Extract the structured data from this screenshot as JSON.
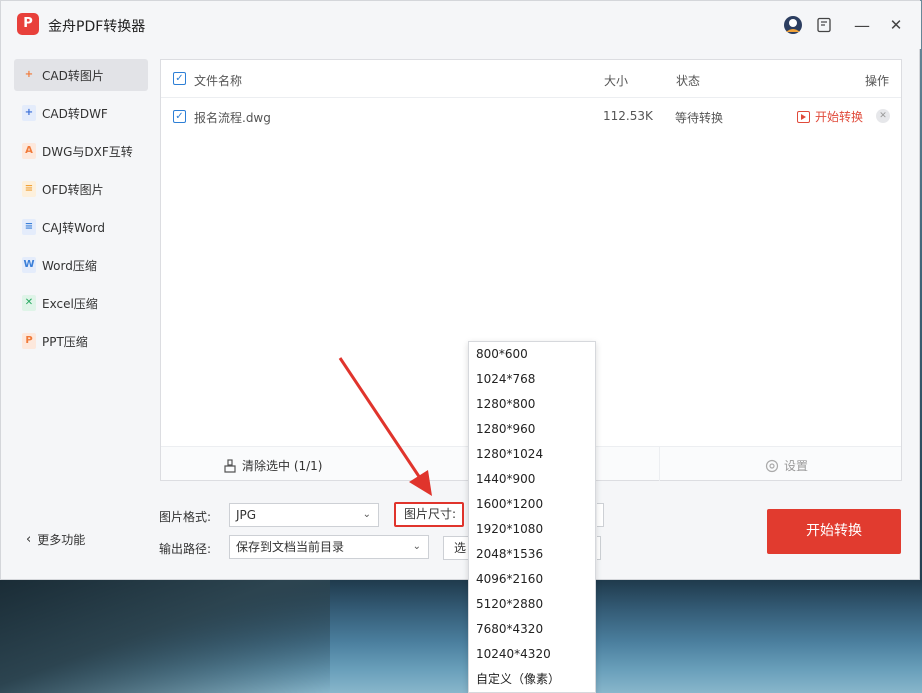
{
  "app": {
    "title": "金舟PDF转换器",
    "logo_text": "P"
  },
  "window_controls": {
    "minimize": "—",
    "close": "✕"
  },
  "sidebar": {
    "items": [
      {
        "label": "CAD转图片",
        "icon": "cad-image-icon",
        "color": "#f07a3a",
        "glyph": "+"
      },
      {
        "label": "CAD转DWF",
        "icon": "cad-dwf-icon",
        "color": "#3b6fd8",
        "glyph": "+"
      },
      {
        "label": "DWG与DXF互转",
        "icon": "dwg-dxf-icon",
        "color": "#f07a3a",
        "glyph": "A"
      },
      {
        "label": "OFD转图片",
        "icon": "ofd-icon",
        "color": "#f0a23a",
        "glyph": "≡"
      },
      {
        "label": "CAJ转Word",
        "icon": "caj-icon",
        "color": "#3b7fd8",
        "glyph": "≡"
      },
      {
        "label": "Word压缩",
        "icon": "word-icon",
        "color": "#3b7fd8",
        "glyph": "W"
      },
      {
        "label": "Excel压缩",
        "icon": "excel-icon",
        "color": "#27a860",
        "glyph": "✕"
      },
      {
        "label": "PPT压缩",
        "icon": "ppt-icon",
        "color": "#f07a3a",
        "glyph": "P"
      }
    ],
    "more_label": "更多功能"
  },
  "file_table": {
    "headers": {
      "name": "文件名称",
      "size": "大小",
      "status": "状态",
      "action": "操作"
    },
    "rows": [
      {
        "name": "报名流程.dwg",
        "size": "112.53K",
        "status": "等待转换",
        "action": "开始转换"
      }
    ],
    "clear_label": "清除选中 (1/1)",
    "settings_label": "设置"
  },
  "controls": {
    "format_label": "图片格式:",
    "format_value": "JPG",
    "size_label": "图片尺寸:",
    "output_label": "输出路径:",
    "output_value": "保存到文档当前目录",
    "pick_label": "选择",
    "convert_label": "开始转换"
  },
  "size_options": [
    "800*600",
    "1024*768",
    "1280*800",
    "1280*960",
    "1280*1024",
    "1440*900",
    "1600*1200",
    "1920*1080",
    "2048*1536",
    "4096*2160",
    "5120*2880",
    "7680*4320",
    "10240*4320",
    "自定义（像素）"
  ],
  "colors": {
    "accent_red": "#e13b2f",
    "checkbox_blue": "#2d7fd6"
  }
}
